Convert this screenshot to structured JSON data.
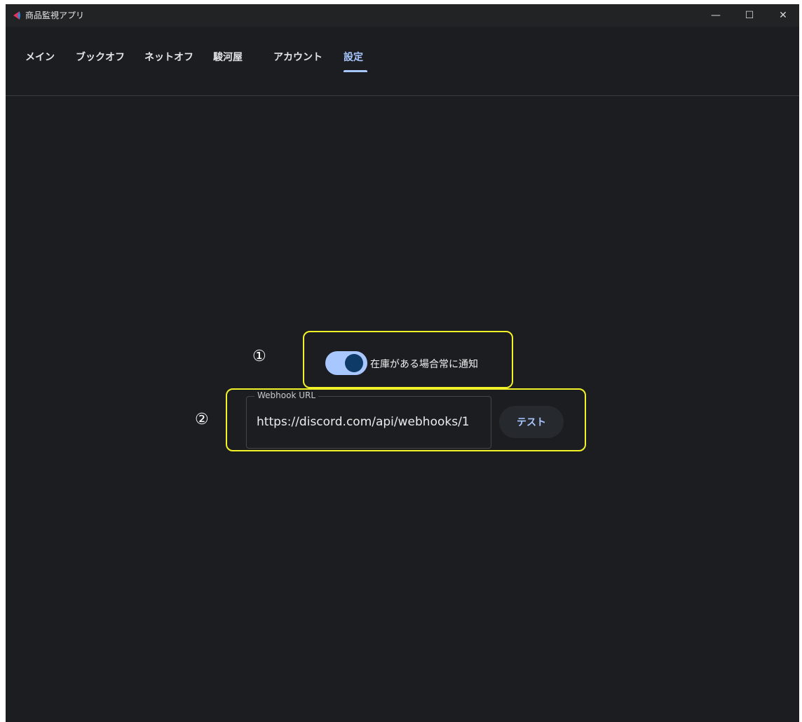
{
  "window": {
    "title": "商品監視アプリ",
    "controls": {
      "minimize": "—",
      "maximize": "☐",
      "close": "✕"
    }
  },
  "tabs": [
    {
      "label": "メイン",
      "active": false
    },
    {
      "label": "ブックオフ",
      "active": false
    },
    {
      "label": "ネットオフ",
      "active": false
    },
    {
      "label": "駿河屋",
      "active": false
    },
    {
      "label": "アカウント",
      "active": false
    },
    {
      "label": "設定",
      "active": true
    }
  ],
  "settings": {
    "annotation_1": "①",
    "annotation_2": "②",
    "notify_toggle": {
      "label": "在庫がある場合常に通知",
      "checked": true
    },
    "webhook": {
      "label": "Webhook URL",
      "value": "https://discord.com/api/webhooks/1",
      "test_button": "テスト"
    }
  },
  "colors": {
    "background": "#1c1d20",
    "accent": "#a9c7ff",
    "highlight": "#f2f229",
    "brand_icon": "#e8315b"
  }
}
